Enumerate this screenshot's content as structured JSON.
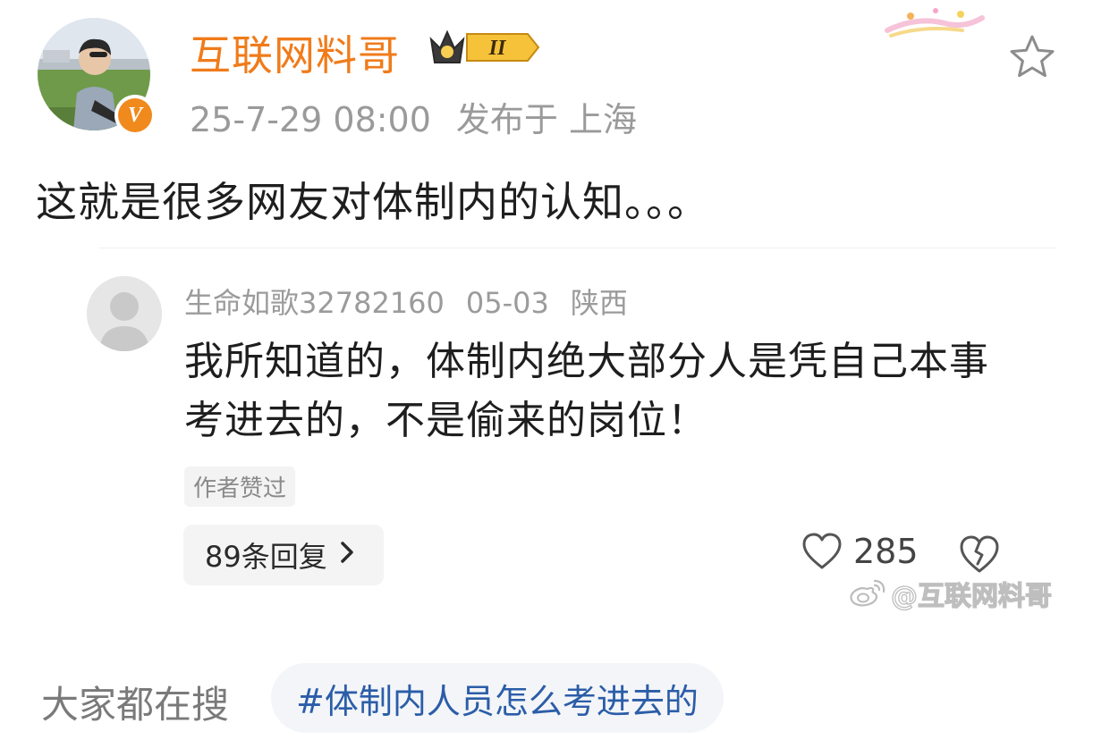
{
  "post": {
    "author_name": "互联网料哥",
    "author_avatar_icon": "user-avatar",
    "verified_icon": "verified-v-icon",
    "verified_mark": "V",
    "level_badge_icon": "crown-level-badge-icon",
    "level_badge_text": "II",
    "date": "25-7-29 08:00",
    "location": "发布于 上海",
    "text": "这就是很多网友对体制内的认知。。。",
    "brand_color": "#f07b1a"
  },
  "comment": {
    "username": "生命如歌32782160",
    "date": "05-03",
    "location": "陕西",
    "text": "我所知道的，体制内绝大部分人是凭自己本事考进去的，不是偷来的岗位！",
    "author_liked": "作者赞过",
    "replies_label": "89条回复",
    "like_count": "285"
  },
  "watermark": {
    "text": "@互联网料哥",
    "icon": "weibo-logo-icon"
  },
  "trending": {
    "label": "大家都在搜",
    "hashtag": "#体制内人员怎么考进去的",
    "hashtag_color": "#2b5da8"
  },
  "icons": {
    "favorite": "star-outline-icon",
    "like": "heart-outline-icon",
    "dislike": "broken-heart-icon",
    "chevron": "chevron-right-icon"
  }
}
